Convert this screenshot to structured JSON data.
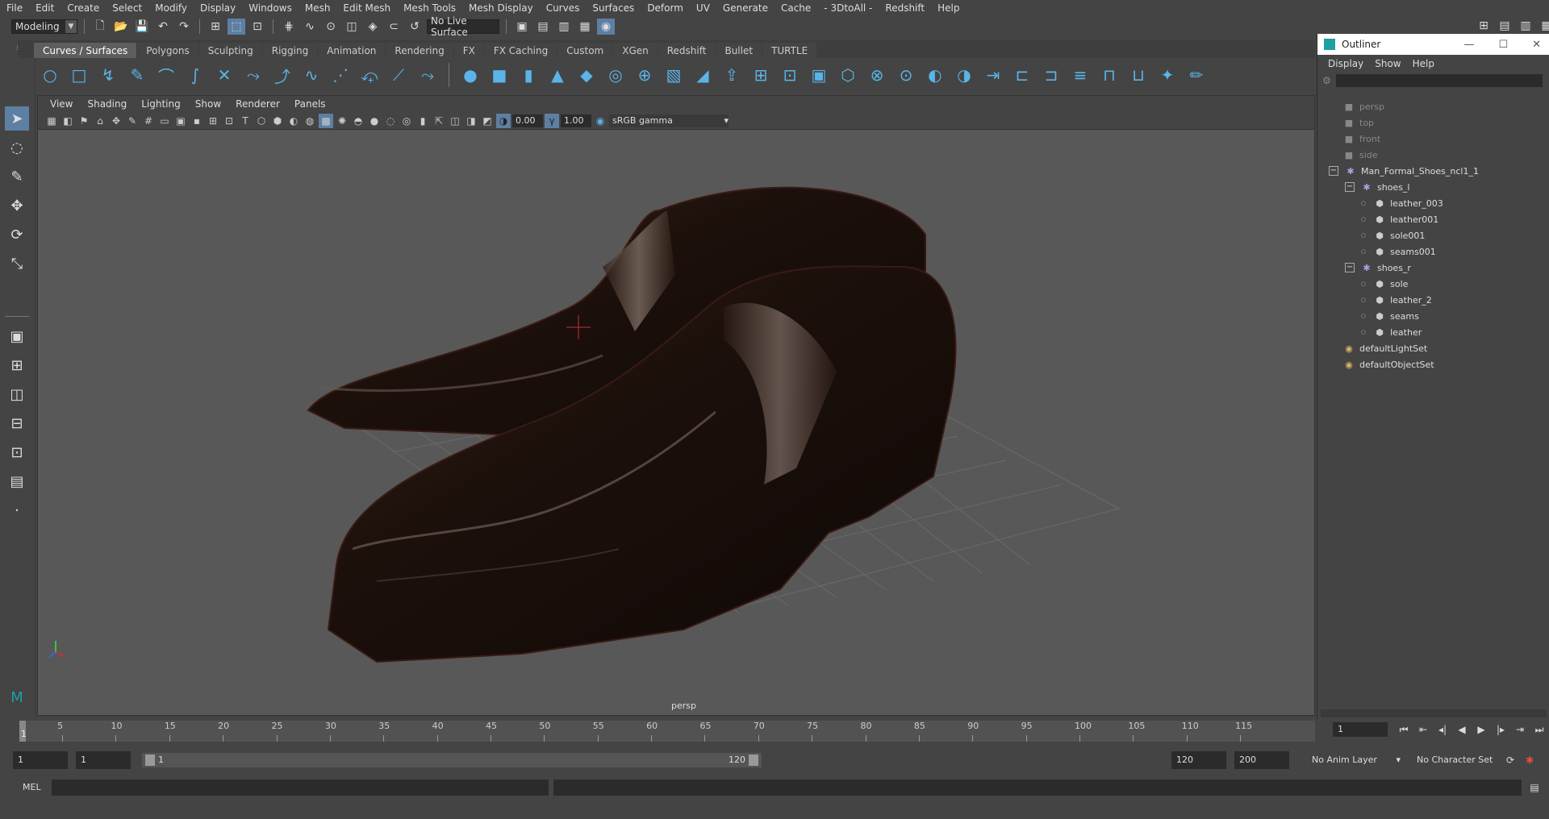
{
  "menubar": [
    "File",
    "Edit",
    "Create",
    "Select",
    "Modify",
    "Display",
    "Windows",
    "Mesh",
    "Edit Mesh",
    "Mesh Tools",
    "Mesh Display",
    "Curves",
    "Surfaces",
    "Deform",
    "UV",
    "Generate",
    "Cache",
    "- 3DtoAll -",
    "Redshift",
    "Help"
  ],
  "status": {
    "mode": "Modeling",
    "live_surface": "No Live Surface"
  },
  "shelf_tabs": [
    "Curves / Surfaces",
    "Polygons",
    "Sculpting",
    "Rigging",
    "Animation",
    "Rendering",
    "FX",
    "FX Caching",
    "Custom",
    "XGen",
    "Redshift",
    "Bullet",
    "TURTLE"
  ],
  "shelf_icons": [
    "circle-icon",
    "square-icon",
    "cv-curve-icon",
    "pencil-curve-icon",
    "ep-curve-icon",
    "arc-icon",
    "bezier-icon",
    "curve-tool-icon",
    "curve-edit-icon",
    "curve-wave-icon",
    "curve-dots-icon",
    "curve-rebuild-icon",
    "curve-project-icon",
    "curve-cut-icon",
    "sphere-icon",
    "cube-icon",
    "cylinder-icon",
    "cone-icon",
    "plane-icon",
    "torus-icon",
    "revolve-icon",
    "loft-icon",
    "planar-icon",
    "extrude-icon",
    "birail-icon",
    "boundary-icon",
    "square-surface-icon",
    "bevel-icon",
    "intersect-icon",
    "project-icon",
    "trim-icon",
    "untrim-icon",
    "extend-icon",
    "attach-icon",
    "detach-icon",
    "align-icon",
    "open-close-icon",
    "insert-isoparm-icon",
    "sculpt-icon",
    "paint-icon"
  ],
  "viewport": {
    "menu": [
      "View",
      "Shading",
      "Lighting",
      "Show",
      "Renderer",
      "Panels"
    ],
    "exposure": "0.00",
    "gamma": "1.00",
    "color_mode": "sRGB gamma",
    "camera": "persp"
  },
  "outliner": {
    "title": "Outliner",
    "menu": [
      "Display",
      "Show",
      "Help"
    ],
    "items": [
      {
        "label": "persp",
        "depth": 0,
        "type": "camera",
        "dim": true
      },
      {
        "label": "top",
        "depth": 0,
        "type": "camera",
        "dim": true
      },
      {
        "label": "front",
        "depth": 0,
        "type": "camera",
        "dim": true
      },
      {
        "label": "side",
        "depth": 0,
        "type": "camera",
        "dim": true
      },
      {
        "label": "Man_Formal_Shoes_ncl1_1",
        "depth": 0,
        "type": "group",
        "expanded": true
      },
      {
        "label": "shoes_l",
        "depth": 1,
        "type": "group",
        "expanded": true
      },
      {
        "label": "leather_003",
        "depth": 2,
        "type": "mesh"
      },
      {
        "label": "leather001",
        "depth": 2,
        "type": "mesh"
      },
      {
        "label": "sole001",
        "depth": 2,
        "type": "mesh"
      },
      {
        "label": "seams001",
        "depth": 2,
        "type": "mesh"
      },
      {
        "label": "shoes_r",
        "depth": 1,
        "type": "group",
        "expanded": true
      },
      {
        "label": "sole",
        "depth": 2,
        "type": "mesh"
      },
      {
        "label": "leather_2",
        "depth": 2,
        "type": "mesh"
      },
      {
        "label": "seams",
        "depth": 2,
        "type": "mesh"
      },
      {
        "label": "leather",
        "depth": 2,
        "type": "mesh"
      },
      {
        "label": "defaultLightSet",
        "depth": 0,
        "type": "set"
      },
      {
        "label": "defaultObjectSet",
        "depth": 0,
        "type": "set"
      }
    ]
  },
  "timeline": {
    "ticks": [
      5,
      10,
      15,
      20,
      25,
      30,
      35,
      40,
      45,
      50,
      55,
      60,
      65,
      70,
      75,
      80,
      85,
      90,
      95,
      100,
      105,
      110,
      115
    ],
    "current_frame": "1",
    "current_field": "1"
  },
  "range": {
    "start": "1",
    "anim_start": "1",
    "range_start": "1",
    "range_end": "120",
    "anim_end": "120",
    "end": "200",
    "anim_layer": "No Anim Layer",
    "character_set": "No Character Set"
  },
  "cmd": {
    "label": "MEL"
  }
}
